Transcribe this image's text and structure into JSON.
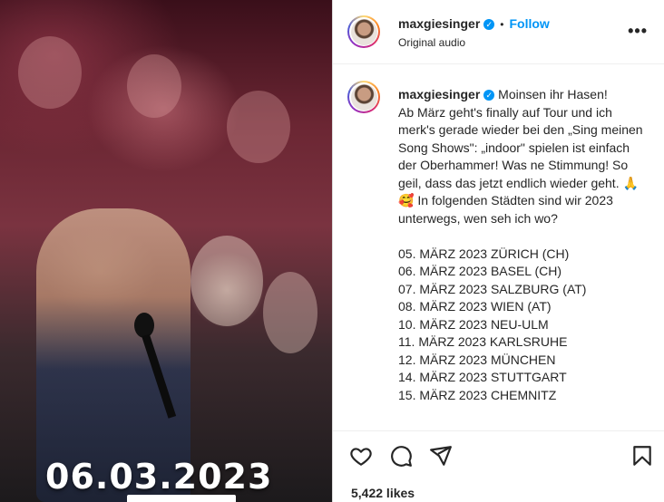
{
  "media": {
    "overlay_date": "06.03.2023"
  },
  "header": {
    "username": "maxgiesinger",
    "follow_label": "Follow",
    "separator": "•",
    "subtitle": "Original audio",
    "more_icon": "more-horizontal-icon"
  },
  "caption": {
    "username": "maxgiesinger",
    "text": "Moinsen ihr Hasen!\nAb März geht's finally auf Tour und ich merk's gerade wieder bei den „Sing meinen Song Shows\": „indoor\" spielen ist einfach der Oberhammer! Was ne Stimmung! So geil, dass das jetzt endlich wieder geht. 🙏🥰 In folgenden Städten sind wir 2023 unterwegs, wen seh ich wo?\n\n05. MÄRZ 2023 ZÜRICH (CH)\n06. MÄRZ 2023 BASEL (CH)\n07. MÄRZ 2023 SALZBURG (AT)\n08. MÄRZ 2023 WIEN (AT)\n10. MÄRZ 2023 NEU-ULM\n11. MÄRZ 2023 KARLSRUHE\n12. MÄRZ 2023 MÜNCHEN\n14. MÄRZ 2023 STUTTGART\n15. MÄRZ 2023 CHEMNITZ"
  },
  "actions": {
    "icons": [
      "heart-icon",
      "comment-icon",
      "share-icon",
      "bookmark-icon"
    ]
  },
  "likes": "5,422 likes",
  "colors": {
    "accent": "#0095f6",
    "text": "#262626",
    "border": "#dbdbdb"
  }
}
